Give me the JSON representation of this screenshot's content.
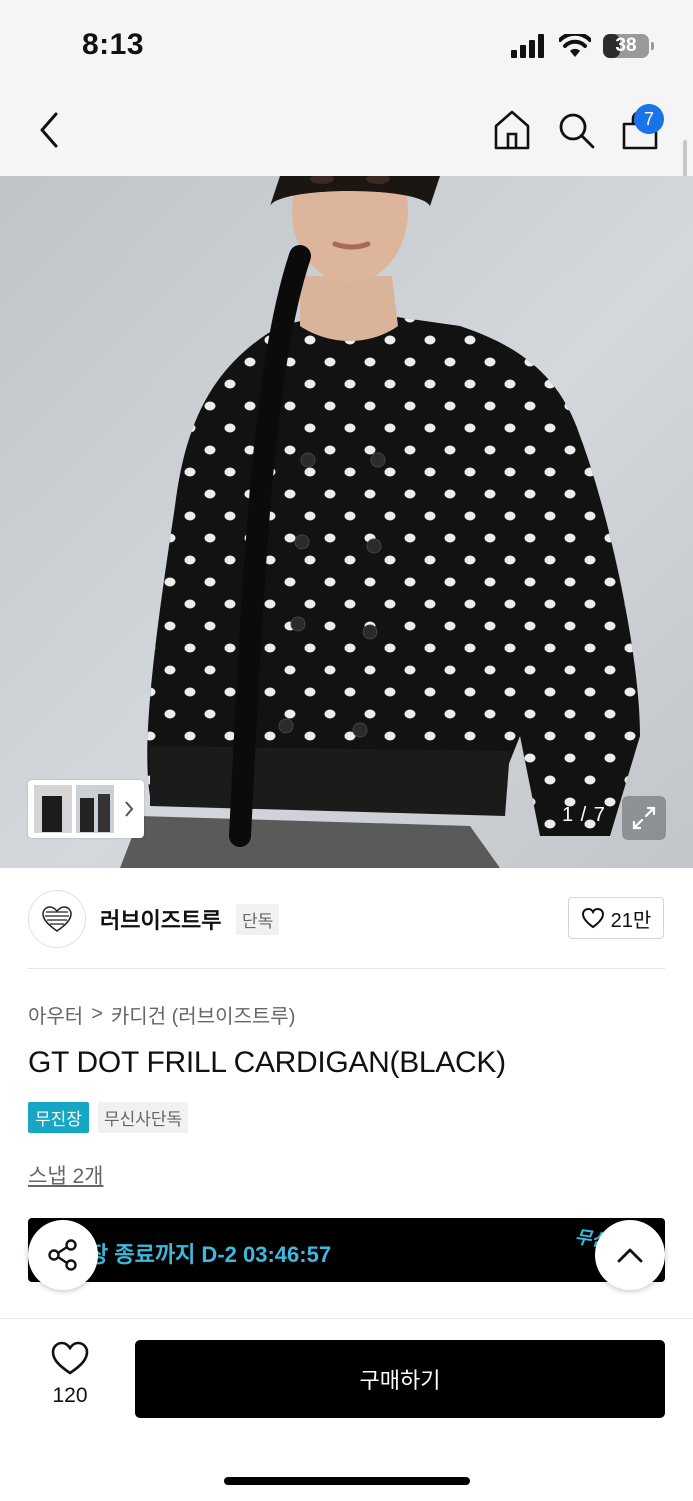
{
  "status_bar": {
    "time": "8:13",
    "battery": "38",
    "battery_level": 0.38
  },
  "nav": {
    "cart_count": "7",
    "back_label": "back",
    "home_label": "home",
    "search_label": "search",
    "cart_label": "cart"
  },
  "hero": {
    "counter": "1 / 7"
  },
  "brand": {
    "name": "러브이즈트루",
    "tag": "단독",
    "likes": "21만"
  },
  "breadcrumb": {
    "category": "아우터",
    "separator": ">",
    "subcategory": "카디건 (러브이즈트루)"
  },
  "product": {
    "title": "GT DOT FRILL CARDIGAN(BLACK)",
    "badges": [
      "무진장",
      "무신사단독"
    ],
    "snap": "스냅 2개",
    "promo": "장 종료까지 D-2 03:46:57",
    "promo_brand": "무신사"
  },
  "bottom": {
    "wish_count": "120",
    "buy_label": "구매하기"
  },
  "colors": {
    "accent_blue": "#1a73e8",
    "cyan_badge": "#15a7c4",
    "promo_text": "#3db9e0"
  }
}
